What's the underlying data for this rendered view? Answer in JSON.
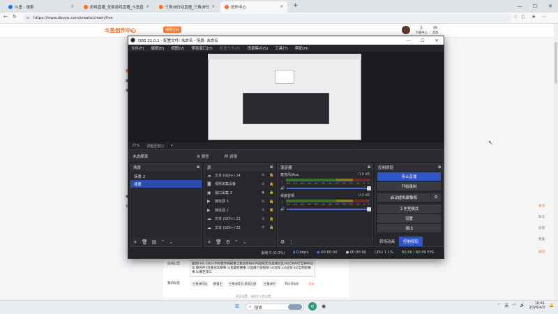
{
  "browser": {
    "tabs": [
      {
        "label": "斗鱼 - 搜索",
        "color": "#1a73e8"
      },
      {
        "label": "游戏直播_全部游戏直播_斗鱼直播",
        "color": "#ff6a1a"
      },
      {
        "label": "三角洲行动直播_三角洲行动直播…",
        "color": "#ff6a1a"
      },
      {
        "label": "创作中心",
        "color": "#ff6a1a"
      }
    ],
    "new_tab": "+",
    "url": "https://www.douyu.com/creator/main/live",
    "win_min": "—",
    "win_max": "☐",
    "win_close": "✕"
  },
  "site": {
    "logo_text": "斗鱼创作中心",
    "logo_badge": "视频主站",
    "header_icons": [
      {
        "label": "下载中心",
        "icon": "download-icon"
      },
      {
        "label": "消息",
        "icon": "bell-icon"
      }
    ],
    "notice_label": "房间公告",
    "notice_text": "暑假FHG EDG PRW携手邮箱重之星战手BAFPS陪陪无尽战线问瓦VALORANT蓝神杯冠军 撕名杯5连胜冠军赛事 斗鱼最新赛事 斗鱼做个短视频 vcl冠军 vct冠军 kol全明星赛事 lol赛区第三",
    "tags_label": "我的标签",
    "tags": [
      "三角洲行动",
      "颜值主",
      "三角洲音乐·其他之战",
      "三角洲行",
      "The Front"
    ],
    "tags_add": "添加",
    "more_text": "更多设置，请前往斗鱼设置"
  },
  "obs": {
    "title": "OBS 31.0.1 - 配置文件: 未命名 - 场景: 未命名",
    "menus": [
      "文件(F)",
      "编辑(E)",
      "视图(V)",
      "停靠窗口(D)",
      "配置文件(P)",
      "场景集合(S)",
      "工具(T)",
      "帮助(H)"
    ],
    "zoom": "27%",
    "zoom_mode": "调整至窗口",
    "no_source": "未选择源",
    "properties": "⚙ 属性",
    "filters": "滤镜",
    "scenes_title": "场景",
    "scenes": [
      "场景 2",
      "场景"
    ],
    "sources_title": "源",
    "sources": [
      {
        "name": "文本 (GDI+) 24",
        "icon": "text-icon"
      },
      {
        "name": "视频采集设备",
        "icon": "camera-icon"
      },
      {
        "name": "窗口采集 3",
        "icon": "window-icon"
      },
      {
        "name": "媒体源 3",
        "icon": "play-icon"
      },
      {
        "name": "媒体源 2",
        "icon": "play-icon"
      },
      {
        "name": "文本 (GDI+) 23",
        "icon": "text-icon"
      },
      {
        "name": "文本 (GDI+) 22",
        "icon": "text-icon"
      }
    ],
    "mixer_title": "混音器",
    "mixer": [
      {
        "name": "麦克风/Aux",
        "db": "0.0 dB",
        "level": 0.55
      },
      {
        "name": "桌面音频",
        "db": "0.0 dB",
        "level": 0.8
      }
    ],
    "meter_ticks": [
      "-60",
      "-55",
      "-50",
      "-45",
      "-40",
      "-35",
      "-30",
      "-25",
      "-20",
      "-15",
      "-10",
      "-5",
      "0"
    ],
    "controls_title": "控制按钮",
    "controls": [
      "停止直播",
      "开始录制",
      "启动虚拟摄像机",
      "工作室模式",
      "设置",
      "退出"
    ],
    "bottom_tabs": [
      "转场动画",
      "控制按钮"
    ],
    "status": {
      "dropped": "丢帧 0 (0.0%)",
      "kbps": "0 kbps",
      "live_time": "00:00:00",
      "rec_time": "00:00:00",
      "cpu": "CPU: 1.1%",
      "fps": "60.00 / 60.00 FPS"
    }
  },
  "taskbar": {
    "search": "搜索",
    "lang": "英",
    "time": "16:41",
    "date": "2026/4/3"
  },
  "right_panel": [
    "关注",
    "私信",
    "反馈",
    "客服",
    "返回"
  ]
}
